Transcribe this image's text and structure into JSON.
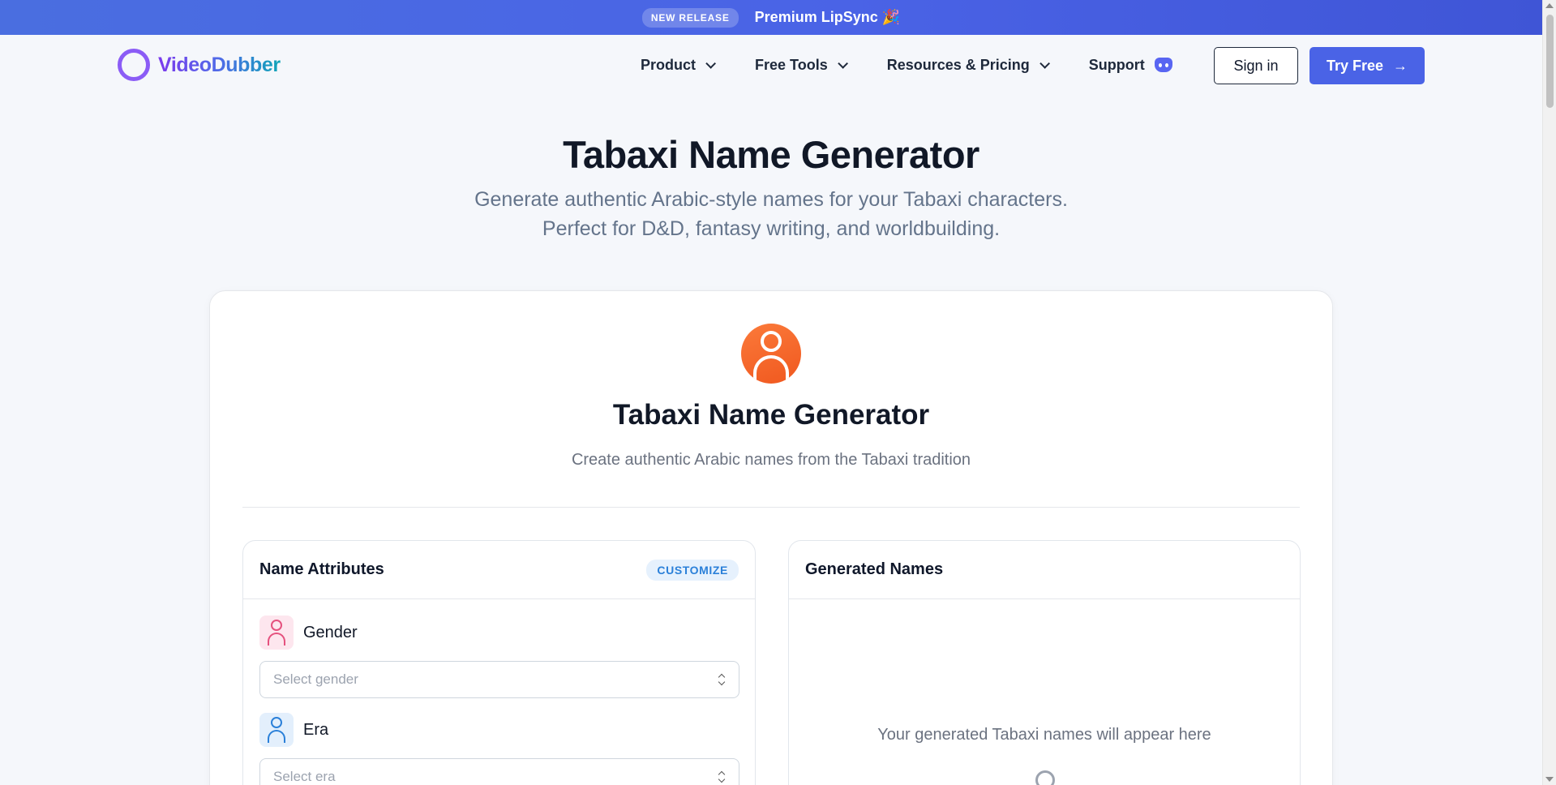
{
  "announcement": {
    "badge": "NEW RELEASE",
    "message": "Premium LipSync 🎉"
  },
  "brand": {
    "name": "VideoDubber"
  },
  "nav": {
    "items": [
      {
        "label": "Product"
      },
      {
        "label": "Free Tools"
      },
      {
        "label": "Resources & Pricing"
      }
    ],
    "support_label": "Support",
    "signin_label": "Sign in",
    "tryfree_label": "Try Free",
    "tryfree_arrow": "→"
  },
  "hero": {
    "title": "Tabaxi Name Generator",
    "subtitle_line1": "Generate authentic Arabic-style names for your Tabaxi characters.",
    "subtitle_line2": "Perfect for D&D, fantasy writing, and worldbuilding."
  },
  "card": {
    "title": "Tabaxi Name Generator",
    "subtitle": "Create authentic Arabic names from the Tabaxi tradition"
  },
  "attributes_panel": {
    "title": "Name Attributes",
    "badge": "CUSTOMIZE",
    "fields": [
      {
        "label": "Gender",
        "placeholder": "Select gender",
        "icon": "user-icon"
      },
      {
        "label": "Era",
        "placeholder": "Select era",
        "icon": "user-icon"
      }
    ]
  },
  "results_panel": {
    "title": "Generated Names",
    "empty_text": "Your generated Tabaxi names will appear here"
  },
  "colors": {
    "accent": "#4a63e6",
    "brand_purple": "#8b5cf6",
    "avatar_orange": "#f0581f"
  }
}
